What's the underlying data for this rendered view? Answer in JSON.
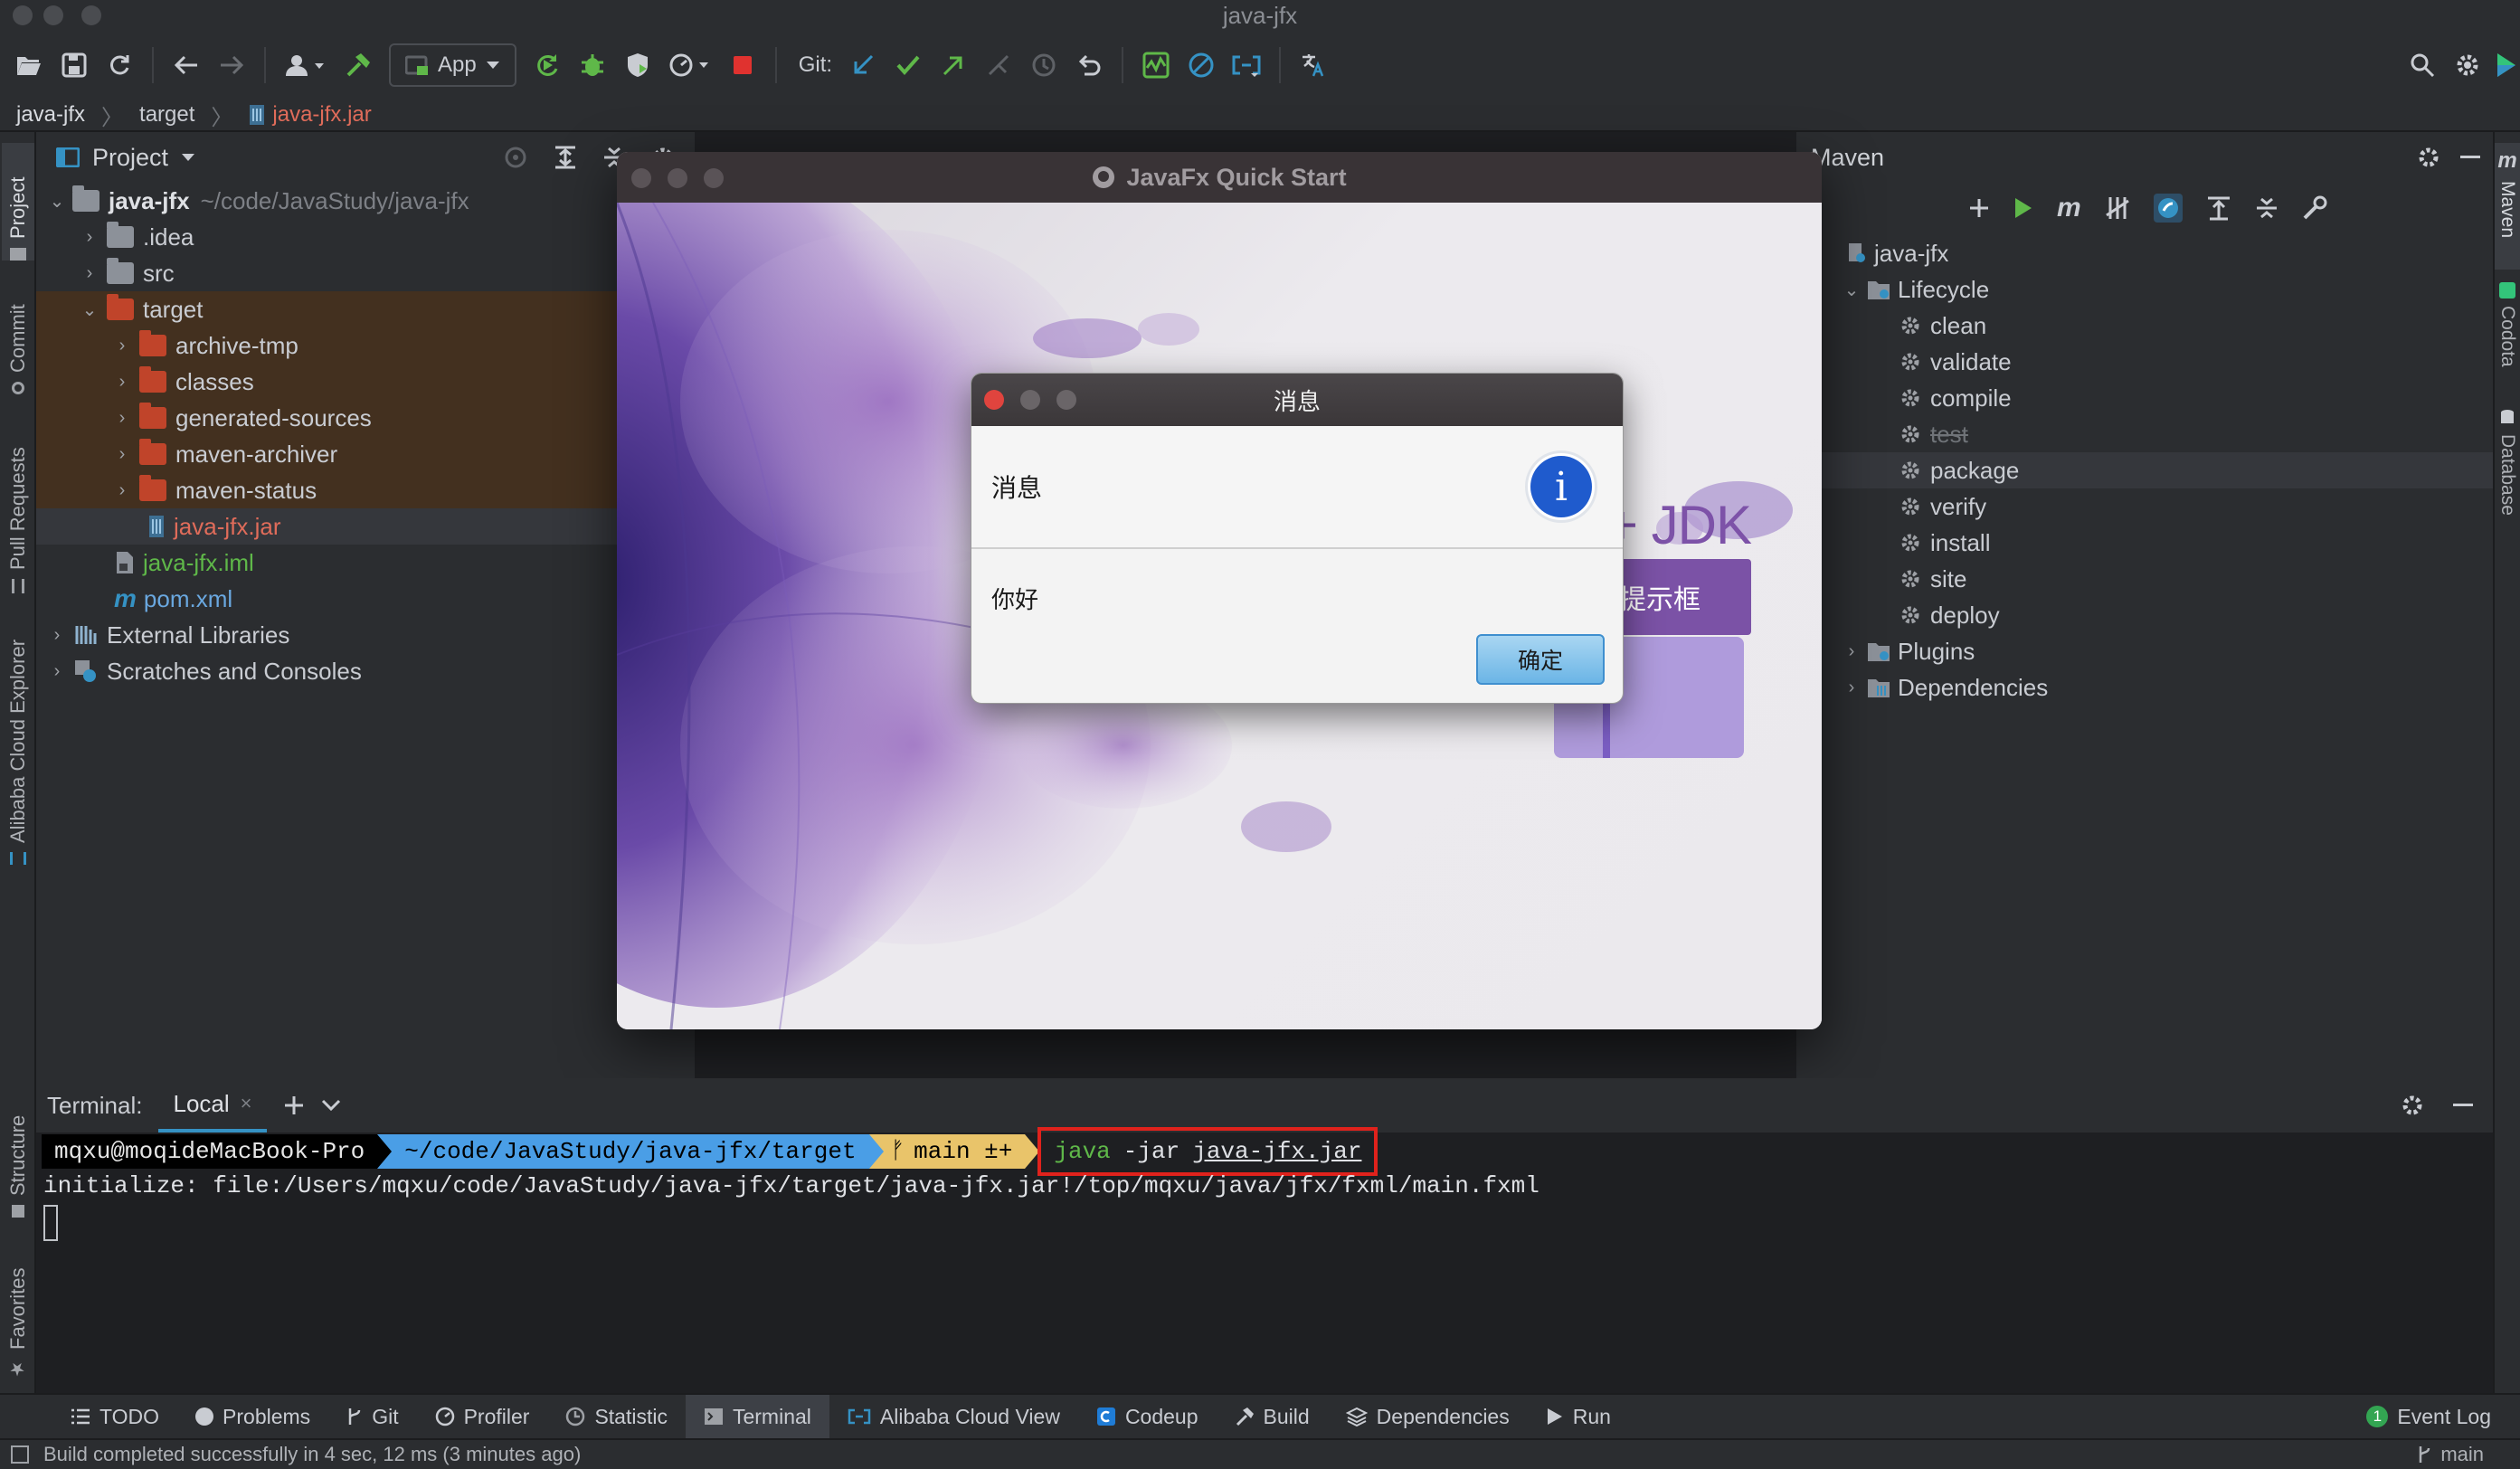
{
  "window": {
    "title": "java-jfx"
  },
  "toolbar": {
    "run_config": "App",
    "git_label": "Git:"
  },
  "breadcrumb": {
    "items": [
      "java-jfx",
      "target",
      "java-jfx.jar"
    ]
  },
  "left_stripe": {
    "tabs": [
      "Project",
      "Commit",
      "Pull Requests",
      "Alibaba Cloud Explorer",
      "Structure",
      "Favorites"
    ]
  },
  "right_stripe": {
    "tabs": [
      "Maven",
      "Codota",
      "Database"
    ]
  },
  "project": {
    "header": "Project",
    "root_name": "java-jfx",
    "root_path": "~/code/JavaStudy/java-jfx",
    "items": [
      {
        "label": ".idea"
      },
      {
        "label": "src"
      },
      {
        "label": "target"
      },
      {
        "label": "archive-tmp"
      },
      {
        "label": "classes"
      },
      {
        "label": "generated-sources"
      },
      {
        "label": "maven-archiver"
      },
      {
        "label": "maven-status"
      },
      {
        "label": "java-jfx.jar"
      },
      {
        "label": "java-jfx.iml"
      },
      {
        "label": "pom.xml"
      },
      {
        "label": "External Libraries"
      },
      {
        "label": "Scratches and Consoles"
      }
    ]
  },
  "maven": {
    "header": "Maven",
    "project": "java-jfx",
    "lifecycle": "Lifecycle",
    "goals": [
      "clean",
      "validate",
      "compile",
      "test",
      "package",
      "verify",
      "install",
      "site",
      "deploy"
    ],
    "plugins": "Plugins",
    "dependencies": "Dependencies"
  },
  "app": {
    "title": "JavaFx Quick Start",
    "heading": "JavaFx 11 + JDK 11",
    "button": "提示框"
  },
  "dialog": {
    "title": "消息",
    "header": "消息",
    "info_glyph": "i",
    "content": "你好",
    "ok_button": "确定"
  },
  "terminal": {
    "label": "Terminal:",
    "tab": "Local",
    "prompt_user": "mqxu@moqideMacBook-Pro",
    "prompt_path": "~/code/JavaStudy/java-jfx/target",
    "prompt_branch": "main ±+",
    "cmd_java": "java",
    "cmd_flag": "-jar",
    "cmd_file": "java-jfx.jar",
    "output": "initialize: file:/Users/mqxu/code/JavaStudy/java-jfx/target/java-jfx.jar!/top/mqxu/java/jfx/fxml/main.fxml"
  },
  "tool_windows": [
    "TODO",
    "Problems",
    "Git",
    "Profiler",
    "Statistic",
    "Terminal",
    "Alibaba Cloud View",
    "Codeup",
    "Build",
    "Dependencies",
    "Run"
  ],
  "event_log": "Event Log",
  "event_count": "1",
  "status": {
    "message": "Build completed successfully in 4 sec, 12 ms (3 minutes ago)",
    "branch": "main"
  },
  "colors": {
    "accent_red": "#e0322f",
    "folder_excluded": "#c0442a",
    "purple": "#7b52a6",
    "green": "#5fb849"
  }
}
